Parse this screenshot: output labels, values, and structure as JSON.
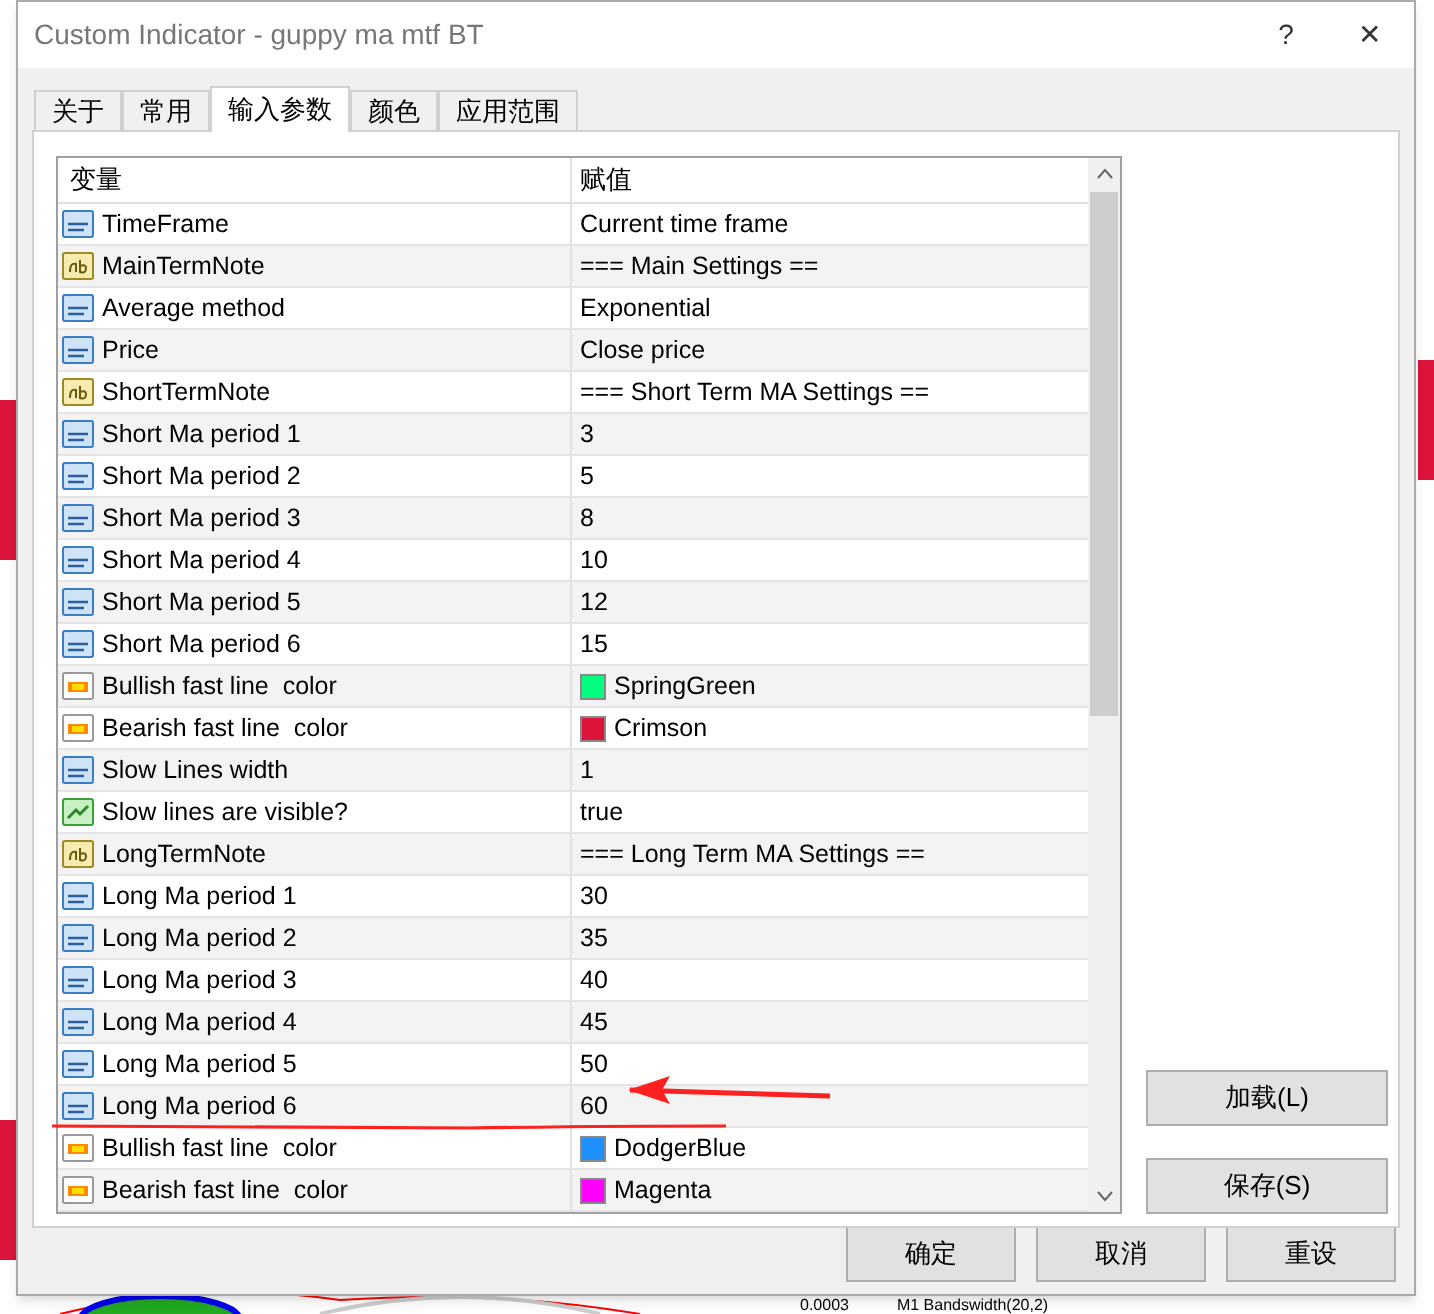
{
  "window": {
    "title": "Custom Indicator - guppy ma mtf BT",
    "help": "?",
    "close": "✕"
  },
  "tabs": [
    {
      "label": "关于",
      "selected": false
    },
    {
      "label": "常用",
      "selected": false
    },
    {
      "label": "输入参数",
      "selected": true
    },
    {
      "label": "颜色",
      "selected": false
    },
    {
      "label": "应用范围",
      "selected": false
    }
  ],
  "table": {
    "columns": [
      "变量",
      "赋值"
    ],
    "rows": [
      {
        "kind": "number",
        "name": "TimeFrame",
        "value": "Current time frame"
      },
      {
        "kind": "text",
        "name": "MainTermNote",
        "value": "=== Main Settings =="
      },
      {
        "kind": "number",
        "name": "Average method",
        "value": "Exponential"
      },
      {
        "kind": "number",
        "name": "Price",
        "value": "Close price"
      },
      {
        "kind": "text",
        "name": "ShortTermNote",
        "value": "=== Short Term MA Settings =="
      },
      {
        "kind": "number",
        "name": "Short Ma period 1",
        "value": "3"
      },
      {
        "kind": "number",
        "name": "Short Ma period 2",
        "value": "5"
      },
      {
        "kind": "number",
        "name": "Short Ma period 3",
        "value": "8"
      },
      {
        "kind": "number",
        "name": "Short Ma period 4",
        "value": "10"
      },
      {
        "kind": "number",
        "name": "Short Ma period 5",
        "value": "12"
      },
      {
        "kind": "number",
        "name": "Short Ma period 6",
        "value": "15"
      },
      {
        "kind": "color",
        "name": "Bullish fast line  color",
        "value": "SpringGreen",
        "color": "#00ff7f"
      },
      {
        "kind": "color",
        "name": "Bearish fast line  color",
        "value": "Crimson",
        "color": "#dc143c"
      },
      {
        "kind": "number",
        "name": "Slow Lines width",
        "value": "1"
      },
      {
        "kind": "bool",
        "name": "Slow lines are visible?",
        "value": "true"
      },
      {
        "kind": "text",
        "name": "LongTermNote",
        "value": "=== Long Term MA Settings =="
      },
      {
        "kind": "number",
        "name": "Long Ma period 1",
        "value": "30"
      },
      {
        "kind": "number",
        "name": "Long Ma period 2",
        "value": "35"
      },
      {
        "kind": "number",
        "name": "Long Ma period 3",
        "value": "40"
      },
      {
        "kind": "number",
        "name": "Long Ma period 4",
        "value": "45"
      },
      {
        "kind": "number",
        "name": "Long Ma period 5",
        "value": "50"
      },
      {
        "kind": "number",
        "name": "Long Ma period 6",
        "value": "60"
      },
      {
        "kind": "color",
        "name": "Bullish fast line  color",
        "value": "DodgerBlue",
        "color": "#1e90ff"
      },
      {
        "kind": "color",
        "name": "Bearish fast line  color",
        "value": "Magenta",
        "color": "#ff00ff"
      }
    ]
  },
  "side_buttons": [
    "加载(L)",
    "保存(S)"
  ],
  "buttons": [
    "确定",
    "取消",
    "重设"
  ],
  "background": {
    "texts": [
      "0.0003",
      "M1 Bandswidth(20,2)"
    ]
  }
}
